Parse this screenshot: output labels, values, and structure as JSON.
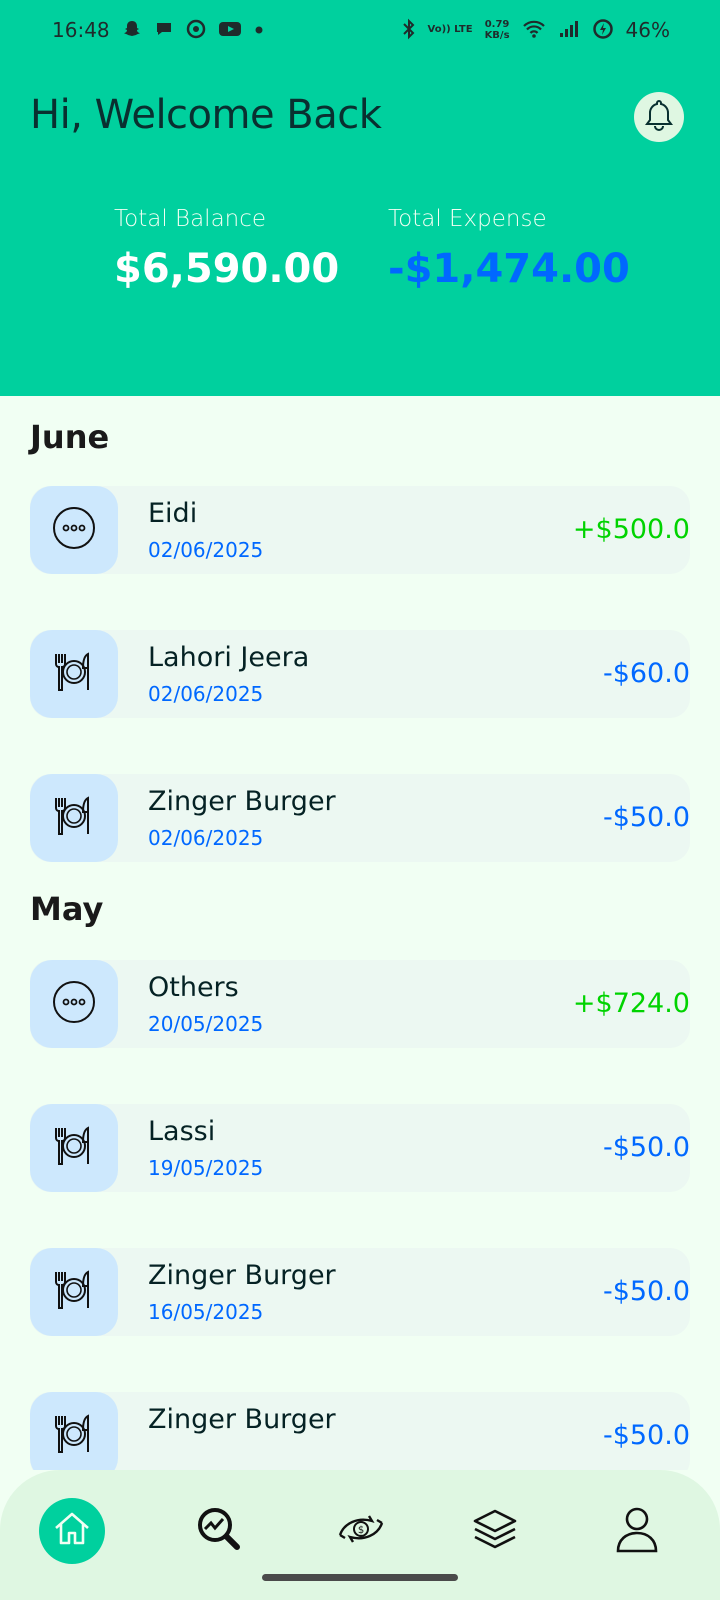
{
  "status_bar": {
    "time": "16:48",
    "network_label": "Vo)) LTE",
    "speed_value": "0.79",
    "speed_unit": "KB/s",
    "battery": "46%"
  },
  "header": {
    "greeting": "Hi, Welcome Back",
    "total_balance_label": "Total Balance",
    "total_balance_value": "$6,590.00",
    "total_expense_label": "Total Expense",
    "total_expense_value": "-$1,474.00"
  },
  "sections": [
    {
      "month": "June",
      "transactions": [
        {
          "title": "Eidi",
          "date": "02/06/2025",
          "amount": "+$500.0",
          "icon": "more-icon"
        },
        {
          "title": "Lahori Jeera",
          "date": "02/06/2025",
          "amount": "-$60.0",
          "icon": "food-icon"
        },
        {
          "title": "Zinger Burger",
          "date": "02/06/2025",
          "amount": "-$50.0",
          "icon": "food-icon"
        }
      ]
    },
    {
      "month": "May",
      "transactions": [
        {
          "title": "Others",
          "date": "20/05/2025",
          "amount": "+$724.0",
          "icon": "more-icon"
        },
        {
          "title": "Lassi",
          "date": "19/05/2025",
          "amount": "-$50.0",
          "icon": "food-icon"
        },
        {
          "title": "Zinger Burger",
          "date": "16/05/2025",
          "amount": "-$50.0",
          "icon": "food-icon"
        },
        {
          "title": "Zinger Burger",
          "date": "",
          "amount": "-$50.0",
          "icon": "food-icon"
        }
      ]
    }
  ],
  "nav": {
    "items": [
      "home-icon",
      "analysis-icon",
      "transactions-icon",
      "categories-icon",
      "profile-icon"
    ],
    "active": "home-icon"
  },
  "colors": {
    "header": "#00D09E",
    "background": "#F1FFF3",
    "income": "#00D300",
    "expense": "#0068FF",
    "icon_tile": "#CDE8FD",
    "nav": "#DFF7E2"
  }
}
